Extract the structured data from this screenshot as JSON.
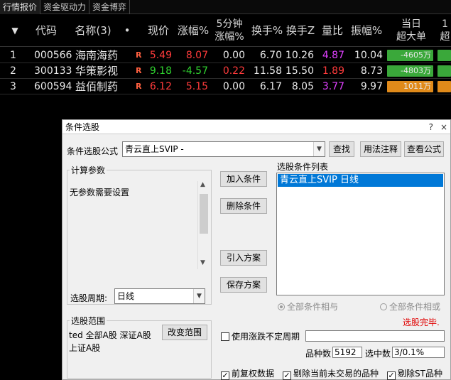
{
  "tabs": [
    "行情报价",
    "资金驱动力",
    "资金博弈"
  ],
  "columns": {
    "sort_arrow": "▼",
    "code": "代码",
    "name": "名称(3)",
    "dot": "•",
    "price": "现价",
    "change_pct": "涨幅%",
    "five_min_line1": "5分钟",
    "five_min_line2": "涨幅%",
    "turnover": "换手%",
    "turnover_z": "换手Z",
    "vol_ratio": "量比",
    "amplitude": "振幅%",
    "today_line1": "当日",
    "today_line2": "超大单",
    "extra_line1": "1",
    "extra_line2": "超"
  },
  "rows": [
    {
      "idx": "1",
      "code": "000566",
      "name": "海南海药",
      "flag": "R",
      "price": "5.49",
      "change": "8.07",
      "five_min": "0.00",
      "turnover": "6.70",
      "turnover_z": "10.26",
      "vol_ratio": "4.87",
      "amplitude": "10.04",
      "super_large": "-4605万",
      "bar_color": "#3aa83a",
      "bar_fill": 1.0
    },
    {
      "idx": "2",
      "code": "300133",
      "name": "华策影视",
      "flag": "R",
      "price": "9.18",
      "change": "-4.57",
      "five_min": "0.22",
      "turnover": "11.58",
      "turnover_z": "15.50",
      "vol_ratio": "1.89",
      "amplitude": "8.73",
      "super_large": "-4803万",
      "bar_color": "#3aa83a",
      "bar_fill": 1.0
    },
    {
      "idx": "3",
      "code": "600594",
      "name": "益佰制药",
      "flag": "R",
      "price": "6.12",
      "change": "5.15",
      "five_min": "0.00",
      "turnover": "6.17",
      "turnover_z": "8.05",
      "vol_ratio": "3.77",
      "amplitude": "9.97",
      "super_large": "1011万",
      "bar_color": "#e08a1a",
      "bar_fill": 1.0
    }
  ],
  "dialog": {
    "title": "条件选股",
    "title_btns": [
      "?",
      "×"
    ],
    "formula_label": "条件选股公式",
    "formula_value": "青云直上SVIP -",
    "btn_find": "查找",
    "btn_usage": "用法注释",
    "btn_view": "查看公式",
    "params_legend": "计算参数",
    "params_text": "无参数需要设置",
    "btn_add": "加入条件",
    "btn_delete": "删除条件",
    "btn_import": "引入方案",
    "btn_save": "保存方案",
    "list_label": "选股条件列表",
    "list_items": [
      "青云直上SVIP  日线"
    ],
    "period_label": "选股周期:",
    "period_value": "日线",
    "radio_and": "全部条件相与",
    "radio_or": "全部条件相或",
    "status": "选股完毕.",
    "status_color": "#e00000",
    "range_legend": "选股范围",
    "range_text_1": "ted 全部A股 深证A股",
    "range_text_2": "上证A股",
    "btn_range": "改变范围",
    "chk_uncertain": "使用涨跌不定周期",
    "count_label": "品种数",
    "count_value": "5192",
    "selected_label": "选中数",
    "selected_value": "3/0.1%",
    "chk_adjust": "前复权数据",
    "chk_exclude_suspended": "剔除当前未交易的品种",
    "chk_exclude_st": "剔除ST品种"
  }
}
